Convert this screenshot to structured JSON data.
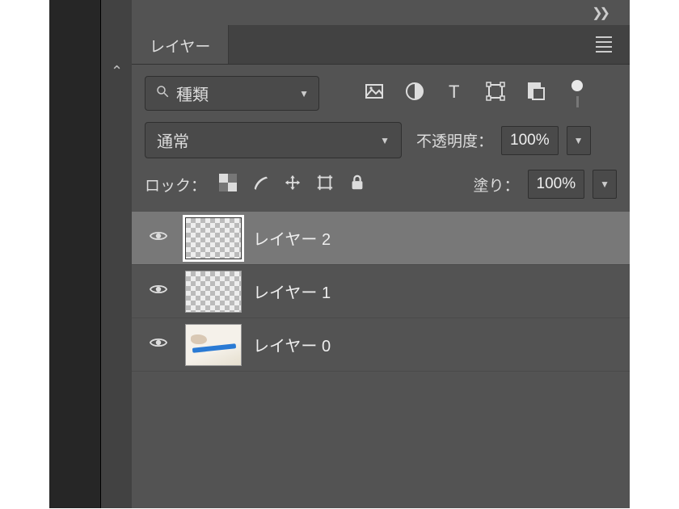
{
  "panel": {
    "tab_title": "レイヤー",
    "filter": {
      "label": "種類",
      "icons": [
        "image-icon",
        "adjustment-icon",
        "type-icon",
        "shape-icon",
        "smartobject-icon"
      ]
    },
    "blend_mode": "通常",
    "opacity": {
      "label": "不透明度：",
      "value": "100%"
    },
    "lock": {
      "label": "ロック："
    },
    "fill": {
      "label": "塗り：",
      "value": "100%"
    },
    "layers": [
      {
        "name": "レイヤー 2",
        "visible": true,
        "thumb": "checker",
        "selected": true
      },
      {
        "name": "レイヤー 1",
        "visible": true,
        "thumb": "checker",
        "selected": false
      },
      {
        "name": "レイヤー 0",
        "visible": true,
        "thumb": "image",
        "selected": false
      }
    ]
  }
}
